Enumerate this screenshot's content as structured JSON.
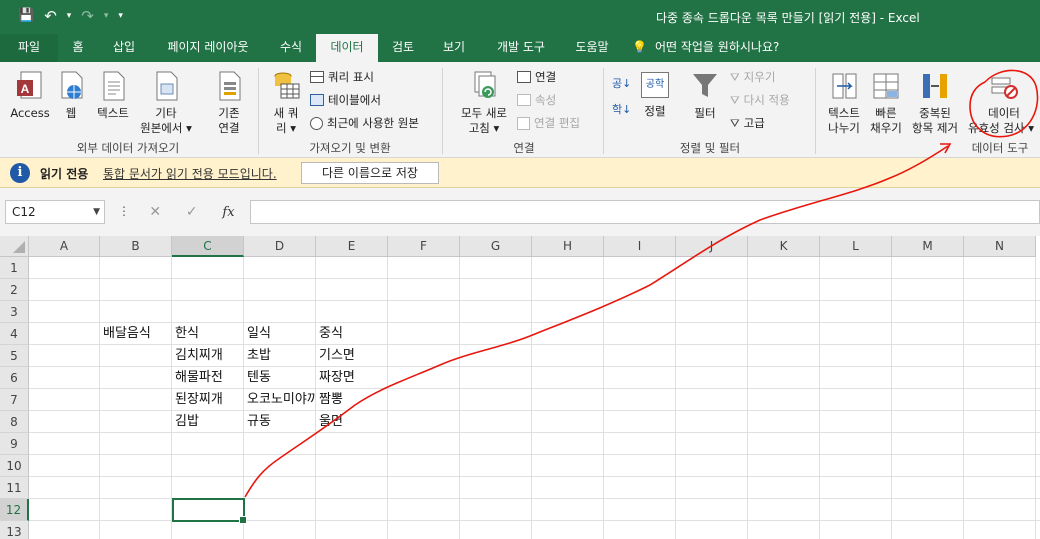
{
  "titlebar": {
    "title": "다중 종속 드롭다운 목록 만들기  [읽기 전용]  -  Excel",
    "qat_save": "💾",
    "qat_undo": "↶",
    "qat_redo": "↷",
    "qat_customize": "▾"
  },
  "tabs": [
    "파일",
    "홈",
    "삽입",
    "페이지 레이아웃",
    "수식",
    "데이터",
    "검토",
    "보기",
    "개발 도구",
    "도움말",
    "어떤 작업을 원하시나요?"
  ],
  "ribbon": {
    "groups": {
      "external": "외부 데이터 가져오기",
      "get_transform": "가져오기 및 변환",
      "connections": "연결",
      "sort_filter": "정렬 및 필터",
      "data_tools": "데이터 도구"
    },
    "external": {
      "access": "Access",
      "web": "웹",
      "text": "텍스트",
      "other_line1": "기타",
      "other_line2": "원본에서 ▾",
      "existing_line1": "기존",
      "existing_line2": "연결"
    },
    "get_transform": {
      "new_query_line1": "새 쿼",
      "new_query_line2": "리 ▾",
      "show_queries": "쿼리 표시",
      "from_table": "테이블에서",
      "recent_sources": "최근에 사용한 원본"
    },
    "connections": {
      "refresh_line1": "모두 새로",
      "refresh_line2": "고침 ▾",
      "connections": "연결",
      "properties": "속성",
      "edit_links": "연결 편집"
    },
    "sort_filter": {
      "sort": "정렬",
      "filter": "필터",
      "clear": "지우기",
      "reapply": "다시 적용",
      "advanced": "고급",
      "sort_az": "공↓",
      "sort_za": "학↓",
      "sort_box": "공학"
    },
    "data_tools": {
      "text_to_columns_line1": "텍스트",
      "text_to_columns_line2": "나누기",
      "flash_fill_line1": "빠른",
      "flash_fill_line2": "채우기",
      "remove_dup_line1": "중복된",
      "remove_dup_line2": "항목 제거",
      "validation_line1": "데이터",
      "validation_line2": "유효성 검사 ▾"
    }
  },
  "msgbar": {
    "label": "읽기 전용",
    "message": "통합 문서가 읽기 전용 모드입니다.",
    "button": "다른 이름으로 저장"
  },
  "formula": {
    "namebox": "C12",
    "dots": "⋮",
    "cancel": "✕",
    "enter": "✓",
    "fx": "fx",
    "value": ""
  },
  "sheet": {
    "columns": [
      "A",
      "B",
      "C",
      "D",
      "E",
      "F",
      "G",
      "H",
      "I",
      "J",
      "K",
      "L",
      "M",
      "N"
    ],
    "rows": [
      "1",
      "2",
      "3",
      "4",
      "5",
      "6",
      "7",
      "8",
      "9",
      "10",
      "11",
      "12",
      "13"
    ],
    "selected_col": "C",
    "selected_row": "12",
    "cells": {
      "B4": "배달음식",
      "C4": "한식",
      "D4": "일식",
      "E4": "중식",
      "C5": "김치찌개",
      "D5": "초밥",
      "E5": "기스면",
      "C6": "해물파전",
      "D6": "텐동",
      "E6": "짜장면",
      "C7": "된장찌개",
      "D7": "오코노미야끼",
      "E7": "짬뽕",
      "C8": "김밥",
      "D8": "규동",
      "E8": "울면"
    }
  },
  "annotation": {
    "color": "#e8160c"
  }
}
